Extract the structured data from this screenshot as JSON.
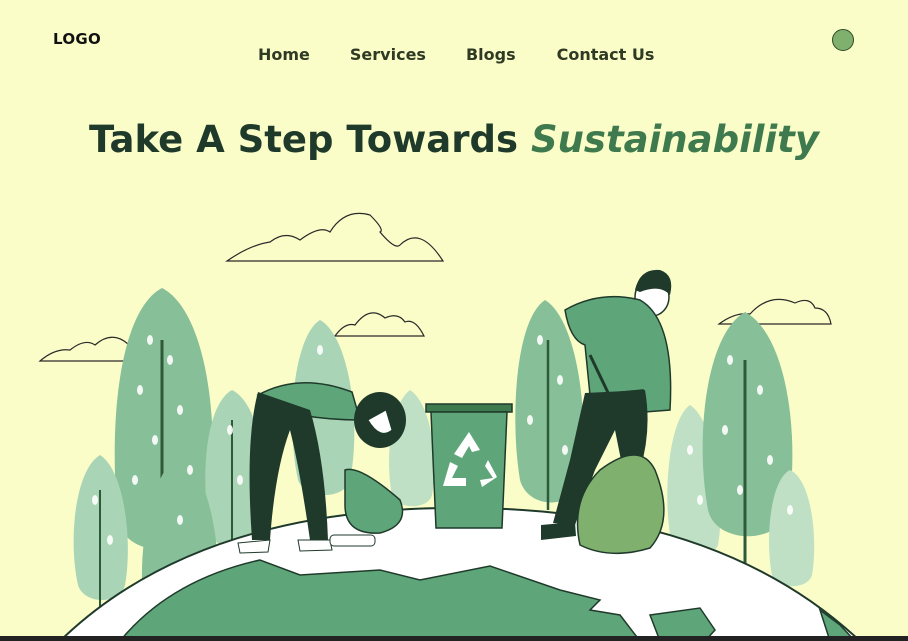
{
  "logo": {
    "text": "LOGO"
  },
  "nav": {
    "items": [
      {
        "label": "Home"
      },
      {
        "label": "Services"
      },
      {
        "label": "Blogs"
      },
      {
        "label": "Contact Us"
      }
    ]
  },
  "hero": {
    "title_main": "Take A Step Towards",
    "title_accent": "Sustainability"
  },
  "icons": {
    "avatar": "profile-avatar-icon",
    "recycle": "recycle-icon"
  },
  "colors": {
    "background": "#fafdc8",
    "accent": "#3f7a4e",
    "tree": "#86bf98",
    "dark": "#1f3a2b"
  }
}
